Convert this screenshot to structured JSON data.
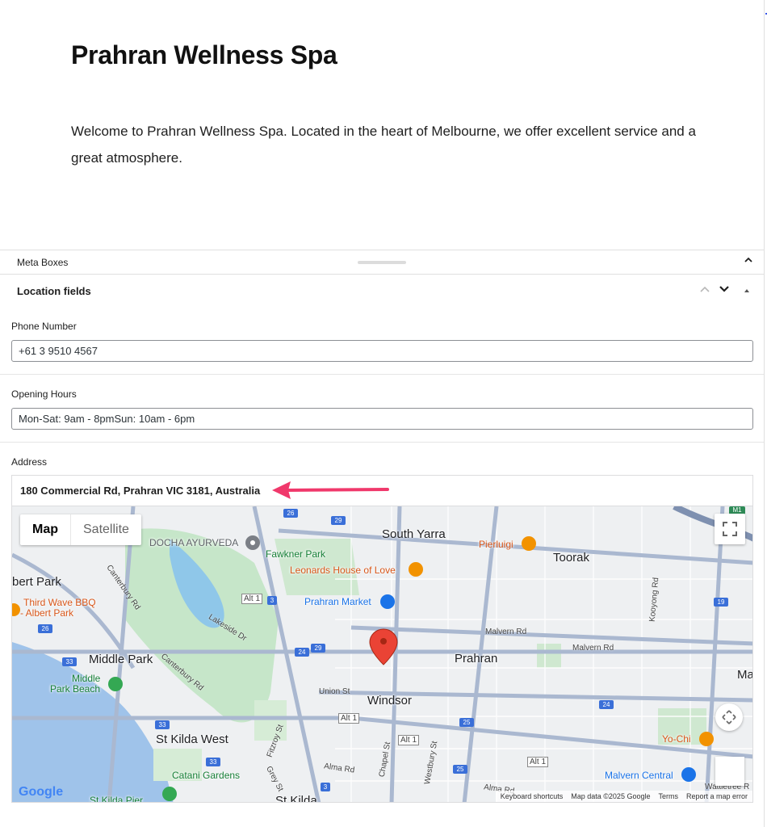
{
  "page": {
    "title": "Prahran Wellness Spa",
    "intro": "Welcome to Prahran Wellness Spa. Located in the heart of Melbourne, we offer excellent service and a great atmosphere."
  },
  "meta_boxes": {
    "label": "Meta Boxes",
    "toggle_icon": "chevron-up-icon"
  },
  "panel": {
    "title": "Location fields",
    "move_up_icon": "chevron-up-icon",
    "move_down_icon": "chevron-down-icon",
    "toggle_icon": "triangle-up-icon"
  },
  "fields": {
    "phone": {
      "label": "Phone Number",
      "value": "+61 3 9510 4567"
    },
    "hours": {
      "label": "Opening Hours",
      "value": "Mon-Sat: 9am - 8pmSun: 10am - 6pm"
    },
    "address": {
      "label": "Address",
      "value": "180 Commercial Rd, Prahran VIC 3181, Australia"
    }
  },
  "annotation": {
    "arrow_color": "#f0386b"
  },
  "map": {
    "type_options": [
      "Map",
      "Satellite"
    ],
    "selected_type": "Map",
    "fullscreen_icon": "fullscreen-icon",
    "pan_icon": "pan-arrows-icon",
    "marker_color": "#ea4335",
    "logo": "Google",
    "attribution": {
      "shortcuts": "Keyboard shortcuts",
      "data": "Map data ©2025 Google",
      "terms": "Terms",
      "report": "Report a map error"
    },
    "places": {
      "south_yarra": "South Yarra",
      "toorak": "Toorak",
      "prahran": "Prahran",
      "windsor": "Windsor",
      "middle_park": "Middle Park",
      "albert_park": "bert Park",
      "st_kilda_west": "St Kilda West",
      "st_kilda": "St Kilda",
      "ma": "Ma",
      "docha": "DOCHA AYURVEDA",
      "fawkner": "Fawkner Park",
      "leonards": "Leonards House of Love",
      "prahran_market": "Prahran Market",
      "pierluigi": "Pierluigi",
      "third_wave": "Third Wave BBQ",
      "albert_park_sub": "- Albert Park",
      "middle_beach": "Middle",
      "park_beach": "Park Beach",
      "catani": "Catani Gardens",
      "st_kilda_pier": "St Kilda Pier",
      "yo_chi": "Yo-Chi",
      "malvern_central": "Malvern Central",
      "wattletree": "Wattletree R"
    },
    "roads": {
      "malvern_rd": "Malvern Rd",
      "malvern_rd2": "Malvern Rd",
      "union_st": "Union St",
      "lakeside": "Lakeside Dr",
      "canterbury": "Canterbury Rd",
      "canterbury2": "Canterbury Rd",
      "alma": "Alma Rd",
      "alma2": "Alma Rd",
      "chapel": "Chapel St",
      "westbury": "Westbury St",
      "fitzroy": "Fitzroy St",
      "grey": "Grey St",
      "kooyong": "Kooyong Rd",
      "alt1a": "Alt 1",
      "alt1b": "Alt 1",
      "alt1c": "Alt 1",
      "alt1d": "Alt 1"
    },
    "shields": [
      "26",
      "29",
      "3",
      "24",
      "29",
      "33",
      "26",
      "33",
      "33",
      "25",
      "25",
      "24",
      "19",
      "3",
      "M1"
    ]
  }
}
